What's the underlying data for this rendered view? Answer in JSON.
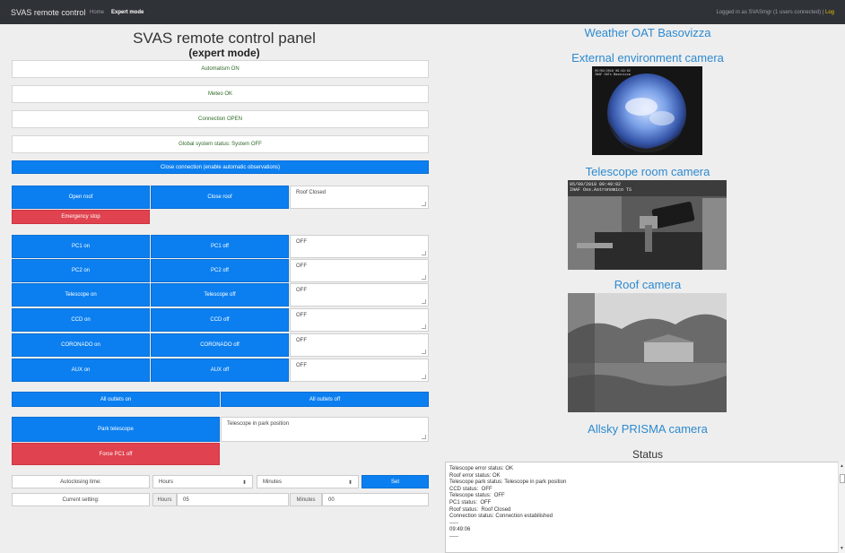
{
  "navbar": {
    "brand": "SVAS remote control",
    "home": "Home",
    "expert": "Expert mode",
    "login_text": "Logged in as SVASmgr (1 users connected) |",
    "logout": "Log"
  },
  "panel": {
    "title": "SVAS remote control panel",
    "subtitle": "(expert mode)"
  },
  "status_boxes": {
    "automatism": "Automatism ON",
    "meteo": "Meteo OK",
    "connection": "Connection OPEN",
    "global": "Global system status: System OFF"
  },
  "close_connection_label": "Close connection (enable automatic observations)",
  "roof": {
    "open": "Open roof",
    "close": "Close roof",
    "status": "Roof Closed",
    "emergency": "Emergency stop"
  },
  "devices": [
    {
      "on": "PC1 on",
      "off": "PC1 off",
      "status": "OFF"
    },
    {
      "on": "PC2 on",
      "off": "PC2 off",
      "status": "OFF"
    },
    {
      "on": "Telescope on",
      "off": "Telescope off",
      "status": "OFF"
    },
    {
      "on": "CCD on",
      "off": "CCD off",
      "status": "OFF"
    },
    {
      "on": "CORONADO on",
      "off": "CORONADO off",
      "status": "OFF"
    },
    {
      "on": "AUX on",
      "off": "AUX off",
      "status": "OFF"
    }
  ],
  "outlets": {
    "all_on": "All outlets on",
    "all_off": "All outlets off"
  },
  "park": {
    "label": "Park telescope",
    "status": "Telescope in park position",
    "force": "Force PC1 off"
  },
  "autoclose": {
    "label": "Autoclosing time:",
    "hours_select": "Hours",
    "minutes_select": "Minutes",
    "set": "Set",
    "current_label": "Current setting:",
    "hours_addon": "Hours",
    "hours_value": "05",
    "minutes_addon": "Minutes",
    "minutes_value": "00"
  },
  "cameras": {
    "weather": "Weather OAT Basovizza",
    "external": "External environment camera",
    "external_overlay_1": "05/09/2018 09:49:02",
    "external_overlay_2": "INAF OATs Basovizza",
    "telescope_room": "Telescope room camera",
    "tel_overlay_1": "05/09/2018 09:49:02",
    "tel_overlay_2": "INAF Oss.Astronomico TS",
    "roof": "Roof camera",
    "allsky": "Allsky PRISMA camera"
  },
  "status": {
    "title": "Status",
    "lines": [
      "Telescope error status: OK",
      "Roof error status: OK",
      "Telescope park status: Telescope in park position",
      "CCD status:  OFF",
      "Telescope status:  OFF",
      "PC1 status:  OFF",
      "Roof status:  Roof Closed",
      "Connection status: Connection estabilished",
      "-----",
      "09:49:06",
      "-----"
    ]
  },
  "colors": {
    "primary": "#0b7ff0",
    "danger": "#e0434f",
    "link": "#2d8ad0",
    "ok_text": "#2f6a28",
    "navbar": "#2f3237"
  }
}
